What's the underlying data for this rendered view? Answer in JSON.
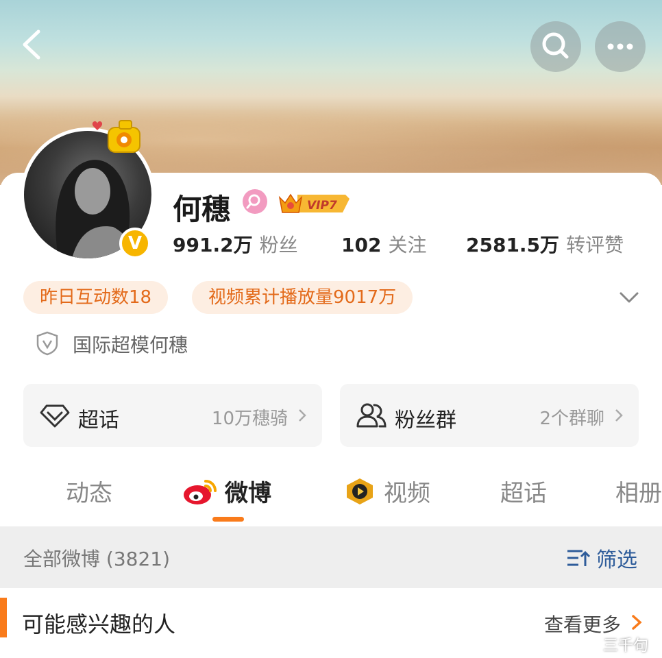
{
  "profile": {
    "name": "何穗",
    "vip_label": "VIP7",
    "verified_mark": "V",
    "description": "国际超模何穗"
  },
  "stats": [
    {
      "value": "991.2万",
      "label": "粉丝"
    },
    {
      "value": "102",
      "label": "关注"
    },
    {
      "value": "2581.5万",
      "label": "转评赞"
    }
  ],
  "chips": [
    {
      "label": "昨日互动数18"
    },
    {
      "label": "视频累计播放量9017万"
    }
  ],
  "entries": {
    "supertopic": {
      "label": "超话",
      "value": "10万穗骑"
    },
    "fan_group": {
      "label": "粉丝群",
      "value": "2个群聊"
    }
  },
  "tabs": [
    {
      "label": "动态",
      "active": false
    },
    {
      "label": "微博",
      "active": true,
      "icon": "weibo-logo-icon"
    },
    {
      "label": "视频",
      "active": false,
      "icon": "video-play-icon"
    },
    {
      "label": "超话",
      "active": false
    },
    {
      "label": "相册",
      "active": false
    }
  ],
  "feed": {
    "total_label": "全部微博 (3821)",
    "filter_label": "筛选"
  },
  "suggest": {
    "title": "可能感兴趣的人",
    "more_label": "查看更多"
  },
  "watermark": "三千句",
  "colors": {
    "accent_orange": "#f97b1b",
    "chip_bg": "#fdeee2",
    "chip_text": "#e36a1a",
    "link_blue": "#2e5c9a",
    "vip_gold": "#f5a623"
  },
  "icons": [
    "back-icon",
    "search-icon",
    "more-icon",
    "gender-female-icon",
    "vip-crown-icon",
    "verified-v-icon",
    "chevron-down-icon",
    "shield-v-icon",
    "supertopic-diamond-icon",
    "fan-group-icon",
    "chevron-right-icon",
    "weibo-logo-icon",
    "video-play-icon",
    "filter-icon"
  ]
}
